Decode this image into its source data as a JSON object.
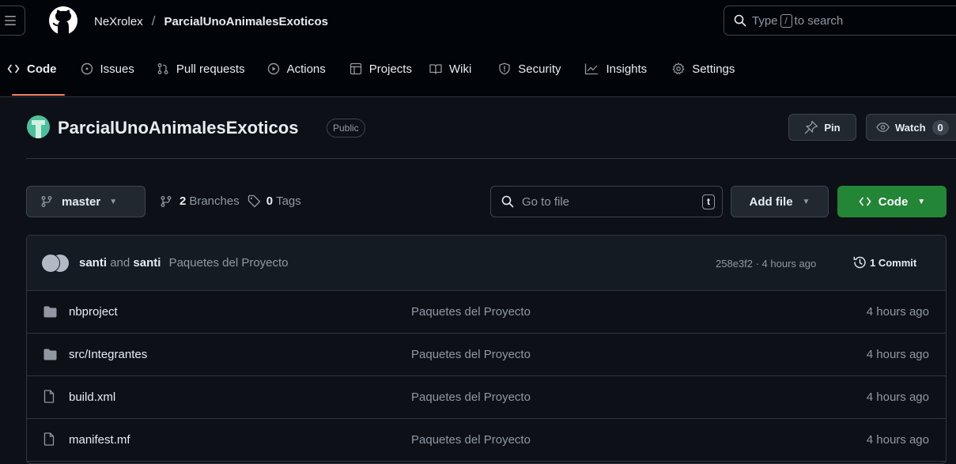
{
  "header": {
    "owner": "NeXrolex",
    "separator": "/",
    "repo": "ParcialUnoAnimalesExoticos",
    "search_prefix": "Type",
    "search_key": "/",
    "search_suffix": "to search"
  },
  "nav": {
    "tabs": [
      {
        "label": "Code",
        "icon": "code-icon"
      },
      {
        "label": "Issues",
        "icon": "issue-icon"
      },
      {
        "label": "Pull requests",
        "icon": "pull-request-icon"
      },
      {
        "label": "Actions",
        "icon": "play-icon"
      },
      {
        "label": "Projects",
        "icon": "table-icon"
      },
      {
        "label": "Wiki",
        "icon": "book-icon"
      },
      {
        "label": "Security",
        "icon": "shield-icon"
      },
      {
        "label": "Insights",
        "icon": "graph-icon"
      },
      {
        "label": "Settings",
        "icon": "gear-icon"
      }
    ],
    "active": "Code"
  },
  "repo": {
    "title": "ParcialUnoAnimalesExoticos",
    "visibility": "Public",
    "pin_label": "Pin",
    "watch_label": "Watch",
    "watch_count": "0"
  },
  "branchbar": {
    "branch": "master",
    "branches_count": "2",
    "branches_label": "Branches",
    "tags_count": "0",
    "tags_label": "Tags",
    "goto_placeholder": "Go to file",
    "goto_key": "t",
    "add_file_label": "Add file",
    "code_label": "Code"
  },
  "latest_commit": {
    "author1": "santi",
    "and": "and",
    "author2": "santi",
    "message": "Paquetes del Proyecto",
    "hash_time": "258e3f2 · 4 hours ago",
    "commits_label": "1 Commit"
  },
  "files": [
    {
      "type": "folder",
      "name": "nbproject",
      "message": "Paquetes del Proyecto",
      "age": "4 hours ago"
    },
    {
      "type": "folder",
      "name": "src/Integrantes",
      "message": "Paquetes del Proyecto",
      "age": "4 hours ago"
    },
    {
      "type": "file",
      "name": "build.xml",
      "message": "Paquetes del Proyecto",
      "age": "4 hours ago"
    },
    {
      "type": "file",
      "name": "manifest.mf",
      "message": "Paquetes del Proyecto",
      "age": "4 hours ago"
    }
  ],
  "colors": {
    "background": "#0d1117",
    "header_bg": "#010409",
    "accent_underline": "#f78166",
    "code_button": "#238636",
    "border": "#30363d"
  }
}
